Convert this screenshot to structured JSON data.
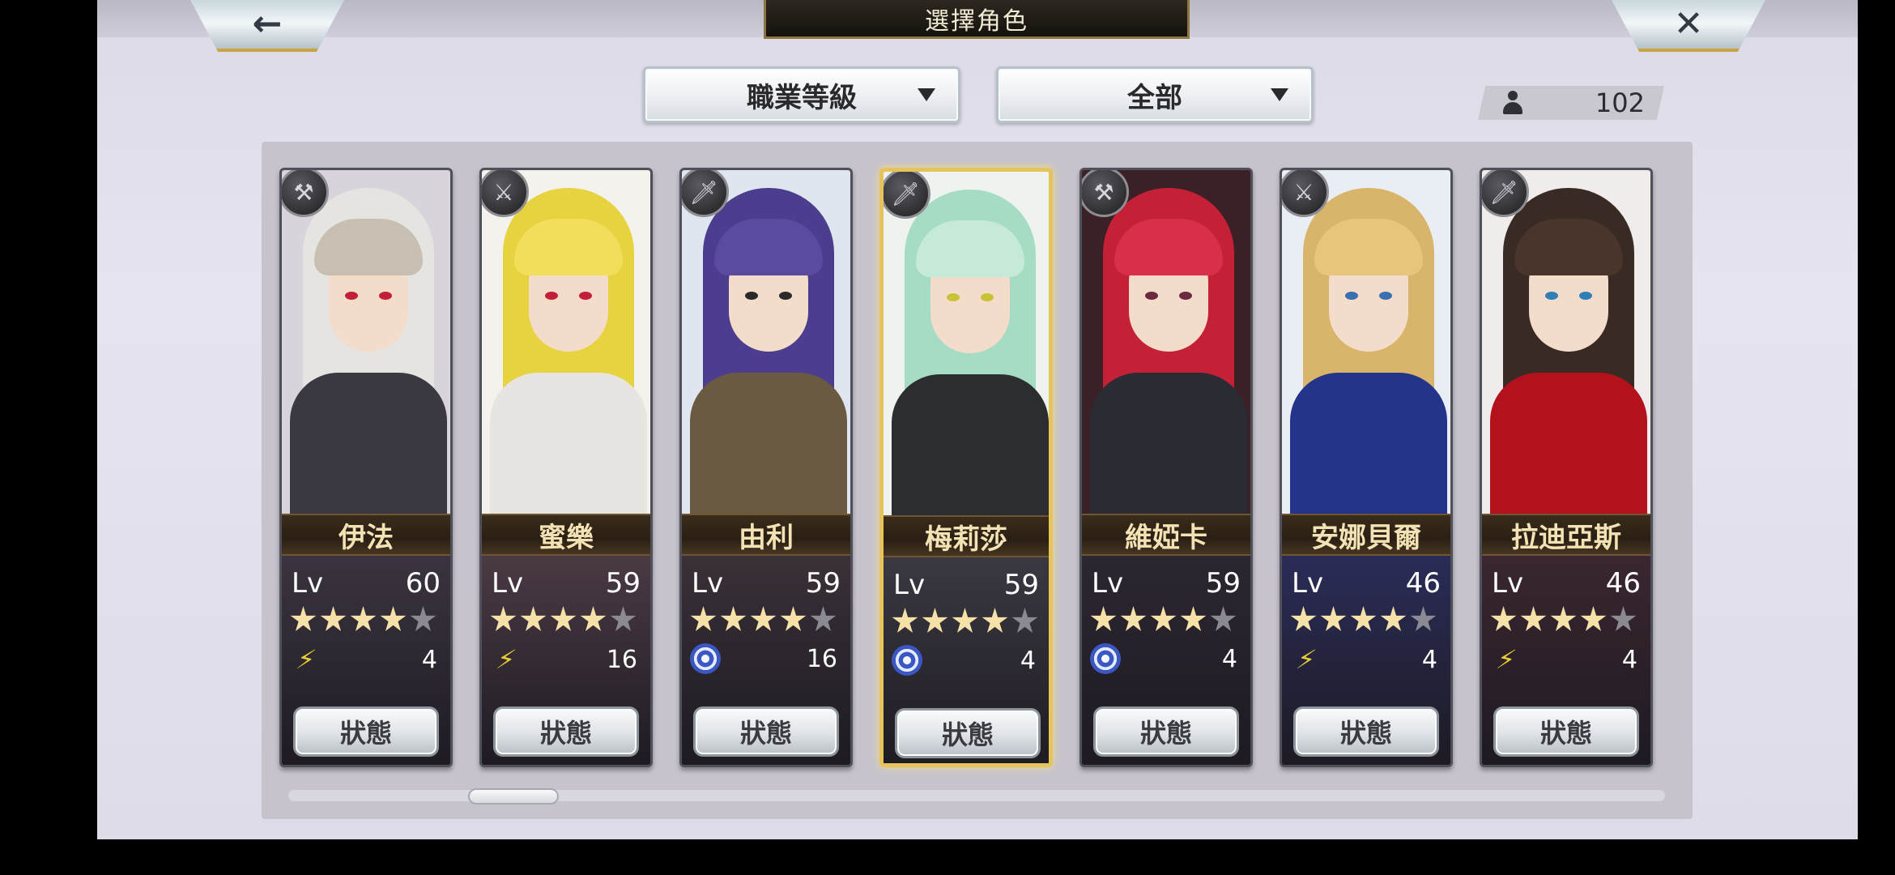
{
  "header": {
    "title": "選擇角色",
    "back_icon": "←",
    "close_icon": "✕"
  },
  "filters": {
    "sort_label": "職業等級",
    "scope_label": "全部"
  },
  "roster_count": "102",
  "status_label": "狀態",
  "level_prefix": "Lv",
  "scrollbar": {
    "position_fraction": 0.14
  },
  "characters": [
    {
      "name": "伊法",
      "level": "60",
      "stars": 4,
      "element": "wing",
      "count": "4",
      "class_icon": "hammer-icon",
      "selected": false,
      "colors": {
        "bg": "#d9d3dc",
        "hair": "#e6e4e0",
        "bangs": "#c7c0b2",
        "eye": "#c21f3a",
        "body": "#3a3840",
        "shade": "#3b3440"
      }
    },
    {
      "name": "蜜樂",
      "level": "59",
      "stars": 4,
      "element": "wing",
      "count": "16",
      "class_icon": "sword-icon",
      "selected": false,
      "colors": {
        "bg": "#f4f2ec",
        "hair": "#e7d23f",
        "bangs": "#f1df5b",
        "eye": "#c21f3a",
        "body": "#e8e4e2",
        "shade": "#4a3a44"
      }
    },
    {
      "name": "由利",
      "level": "59",
      "stars": 4,
      "element": "swirl",
      "count": "16",
      "class_icon": "blade-icon",
      "selected": false,
      "colors": {
        "bg": "#dfe6ef",
        "hair": "#4c3d8e",
        "bangs": "#5a4aa0",
        "eye": "#2a2a2a",
        "body": "#6b5a42",
        "shade": "#3a3038"
      }
    },
    {
      "name": "梅莉莎",
      "level": "59",
      "stars": 4,
      "element": "swirl",
      "count": "4",
      "class_icon": "blade-icon",
      "selected": true,
      "colors": {
        "bg": "#eef3ef",
        "hair": "#a7dcc4",
        "bangs": "#c5ead8",
        "eye": "#c7c236",
        "body": "#2c2d30",
        "shade": "#3a3840"
      }
    },
    {
      "name": "維婭卡",
      "level": "59",
      "stars": 4,
      "element": "swirl",
      "count": "4",
      "class_icon": "hammer-icon",
      "selected": false,
      "colors": {
        "bg": "#3b2028",
        "hair": "#c42136",
        "bangs": "#d8304a",
        "eye": "#6b2a40",
        "body": "#2b2c33",
        "shade": "#2c2630"
      }
    },
    {
      "name": "安娜貝爾",
      "level": "46",
      "stars": 4,
      "element": "wing",
      "count": "4",
      "class_icon": "sword-icon",
      "selected": false,
      "colors": {
        "bg": "#e9eef4",
        "hair": "#d9b56c",
        "bangs": "#e8c57c",
        "eye": "#3a6fb0",
        "body": "#23348a",
        "shade": "#2a2c58"
      }
    },
    {
      "name": "拉迪亞斯",
      "level": "46",
      "stars": 4,
      "element": "wing",
      "count": "4",
      "class_icon": "blade-icon",
      "selected": false,
      "colors": {
        "bg": "#f0ecec",
        "hair": "#3a2a24",
        "bangs": "#4a352c",
        "eye": "#2f7fb6",
        "body": "#b3121c",
        "shade": "#3a2630"
      }
    }
  ]
}
